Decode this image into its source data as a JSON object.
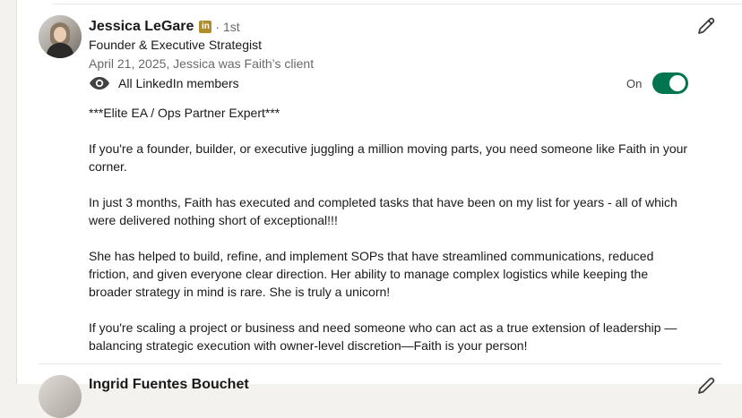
{
  "recommendation": {
    "name": "Jessica LeGare",
    "badge": "in",
    "degree": "· 1st",
    "headline": "Founder & Executive Strategist",
    "meta": "April 21, 2025, Jessica was Faith’s client",
    "visibility": "All LinkedIn members",
    "toggle_label": "On",
    "toggle_on": true,
    "body": [
      "***Elite EA / Ops Partner Expert***",
      "If you're a founder, builder, or executive juggling a million moving parts, you need someone like Faith in your corner.",
      "In just 3 months, Faith has executed and completed tasks that have been on my list for years - all of which were delivered nothing short of exceptional!!!",
      "She has helped to build, refine, and implement SOPs that have streamlined communications, reduced friction, and given everyone clear direction. Her ability to manage complex logistics while keeping the broader strategy in mind is rare. She is truly a unicorn!",
      "If you're scaling a project or business and need someone who can act as a true extension of leadership —balancing strategic execution with owner-level discretion—Faith is your person!"
    ]
  },
  "next_recommendation": {
    "name_partial": "Ingrid Fuentes Bouchet"
  },
  "icons": {
    "visibility": "eye-icon",
    "edit": "pencil-icon"
  },
  "colors": {
    "toggle_on": "#01754f",
    "linkedin_badge": "#b08d2a"
  }
}
